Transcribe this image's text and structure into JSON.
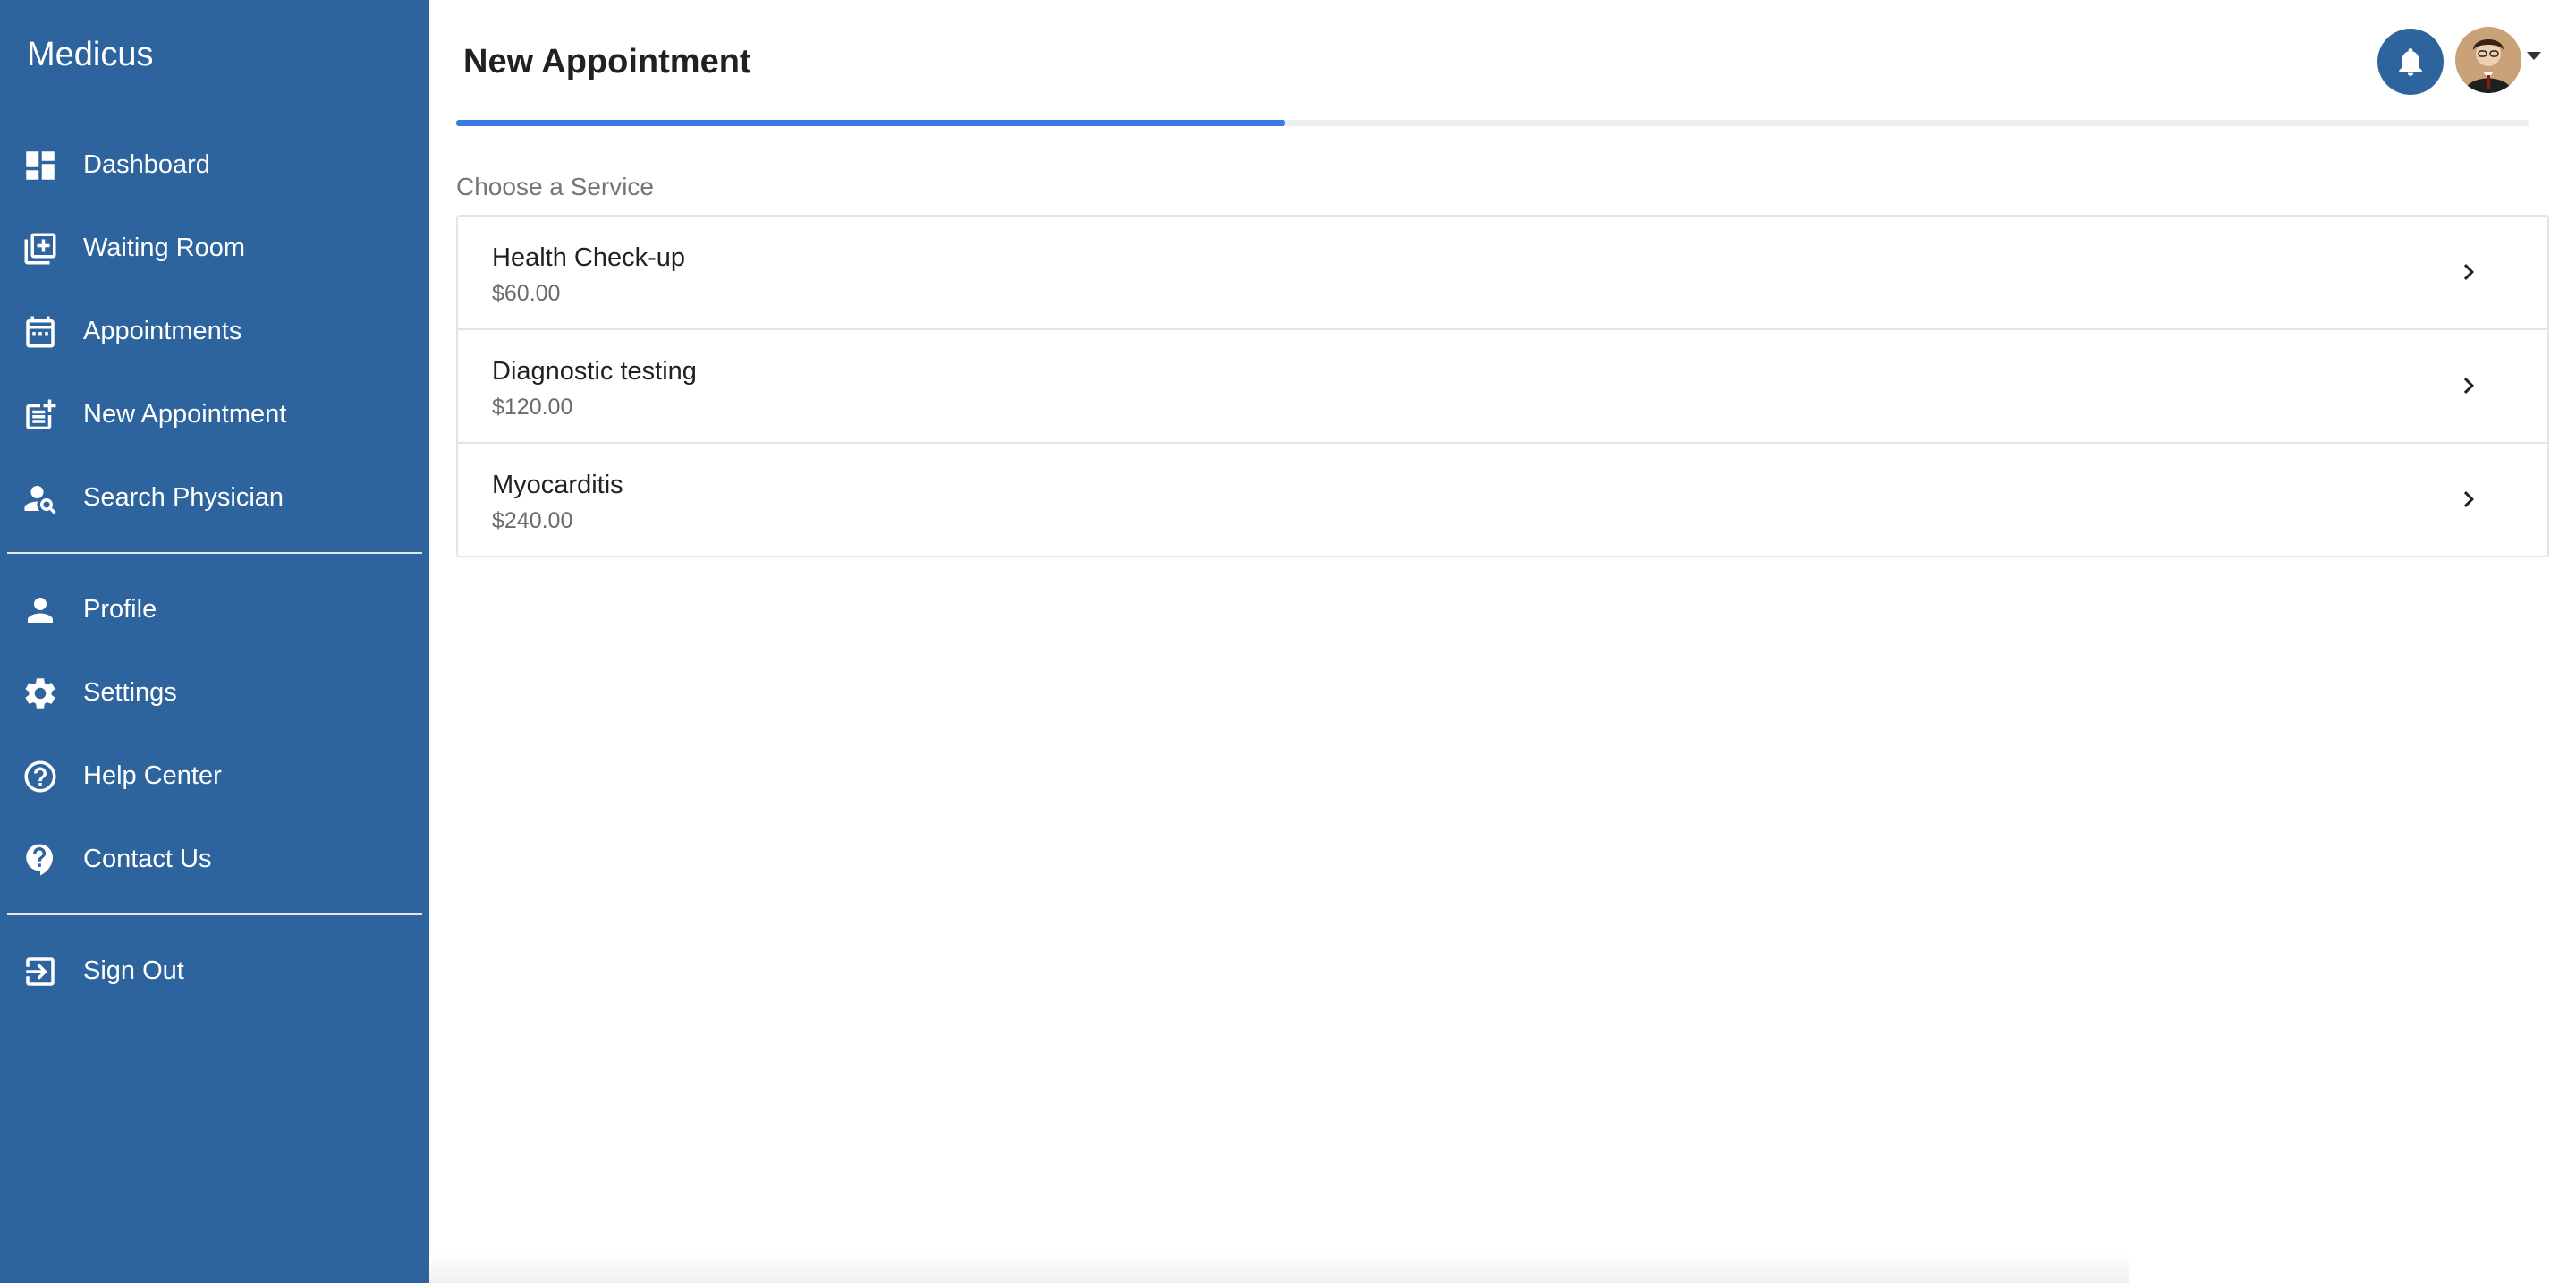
{
  "app": {
    "brand": "Medicus"
  },
  "sidebar": {
    "items": [
      {
        "label": "Dashboard",
        "icon": "dashboard-icon"
      },
      {
        "label": "Waiting Room",
        "icon": "library-add-icon"
      },
      {
        "label": "Appointments",
        "icon": "calendar-icon"
      },
      {
        "label": "New Appointment",
        "icon": "post-add-icon"
      },
      {
        "label": "Search Physician",
        "icon": "person-search-icon"
      }
    ],
    "account_items": [
      {
        "label": "Profile",
        "icon": "person-icon"
      },
      {
        "label": "Settings",
        "icon": "gear-icon"
      },
      {
        "label": "Help Center",
        "icon": "help-circle-icon"
      },
      {
        "label": "Contact Us",
        "icon": "contact-support-icon"
      }
    ],
    "sign_out": {
      "label": "Sign Out",
      "icon": "logout-icon"
    }
  },
  "header": {
    "title": "New Appointment",
    "progress_percent": 40,
    "notification_icon": "bell-icon",
    "avatar_icon": "user-avatar",
    "menu_icon": "caret-down-icon"
  },
  "main": {
    "section_label": "Choose a Service",
    "services": [
      {
        "name": "Health Check-up",
        "price": "$60.00"
      },
      {
        "name": "Diagnostic testing",
        "price": "$120.00"
      },
      {
        "name": "Myocarditis",
        "price": "$240.00"
      }
    ]
  },
  "colors": {
    "sidebar_bg": "#2e649d",
    "accent": "#3a7be0",
    "progress_track": "#eeeeee"
  }
}
